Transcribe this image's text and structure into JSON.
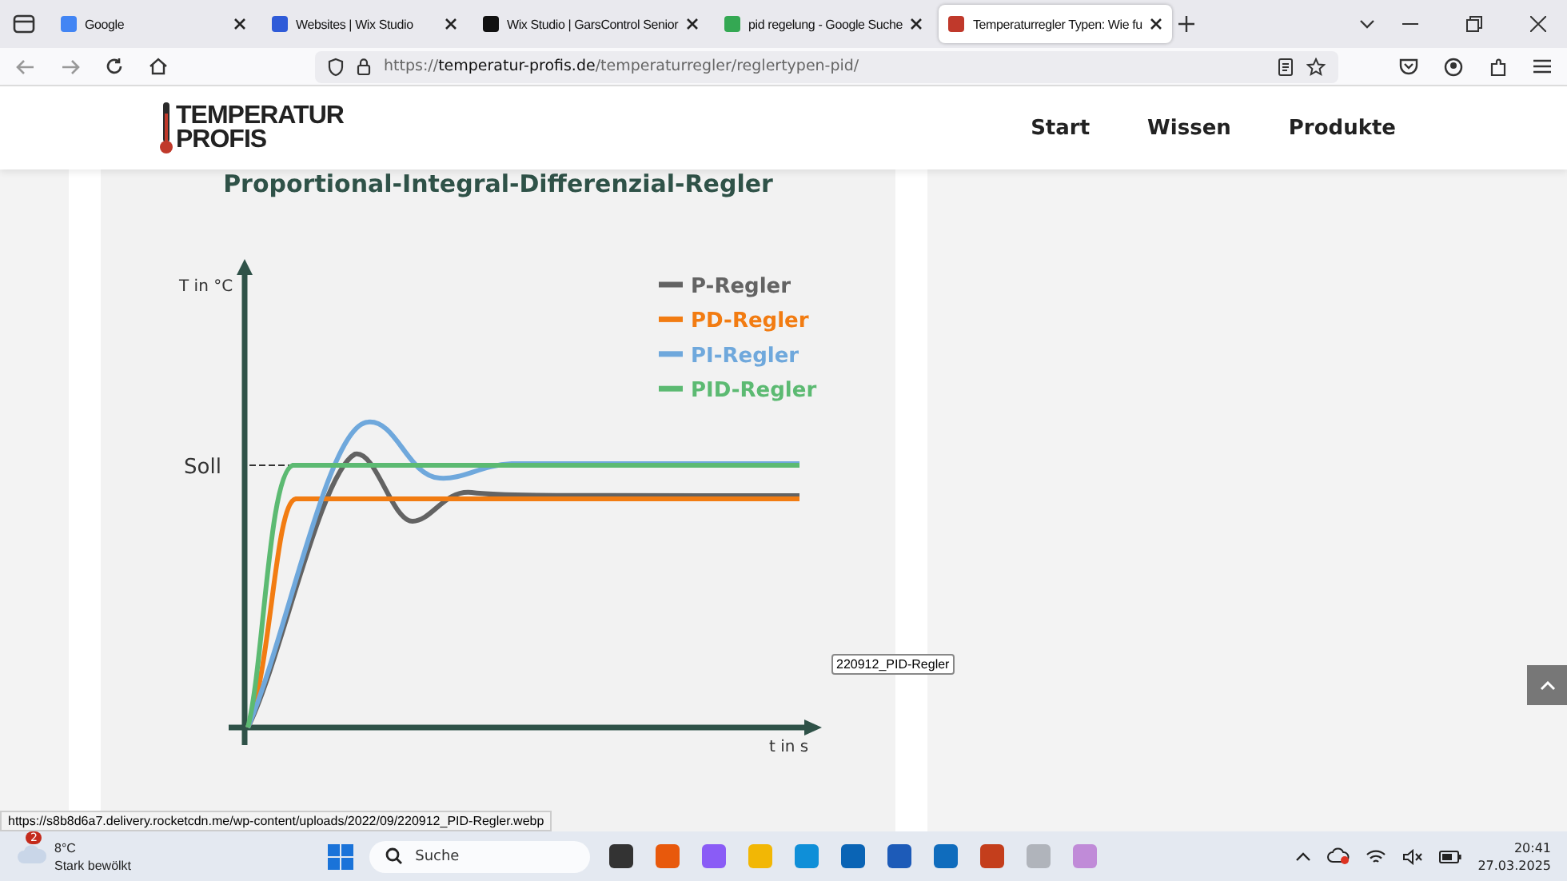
{
  "browser": {
    "tabs": [
      {
        "title": "Google",
        "selected": false
      },
      {
        "title": "Websites | Wix Studio",
        "selected": false
      },
      {
        "title": "Wix Studio | GarsControl Senior",
        "selected": false
      },
      {
        "title": "pid regelung - Google Suche",
        "selected": false
      },
      {
        "title": "Temperaturregler Typen: Wie fu",
        "selected": true
      }
    ],
    "url": "https://**temperatur-profis.de**/temperaturregler/reglertypen-pid/",
    "status_url": "https://s8b8d6a7.delivery.rocketcdn.me/wp-content/uploads/2022/09/220912_PID-Regler.webp"
  },
  "site": {
    "logo": [
      "TEMPERATUR",
      "PROFIS"
    ],
    "nav": [
      "Start",
      "Wissen",
      "Produkte"
    ]
  },
  "figure": {
    "title": "Proportional-Integral-Differenzial-Regler",
    "y_axis_label": "T in °C",
    "x_axis_label": "t in s",
    "setpoint_label": "Soll",
    "legend": [
      {
        "label": "P-Regler",
        "color": "#636363"
      },
      {
        "label": "PD-Regler",
        "color": "#f27c12"
      },
      {
        "label": "PI-Regler",
        "color": "#6fa8dc"
      },
      {
        "label": "PID-Regler",
        "color": "#5cba72"
      }
    ],
    "tooltip": "220912_PID-Regler"
  },
  "taskbar": {
    "weather_badge": "2",
    "temperature": "8°C",
    "weather": "Stark bewölkt",
    "search_placeholder": "Suche",
    "time": "20:41",
    "date": "27.03.2025"
  }
}
